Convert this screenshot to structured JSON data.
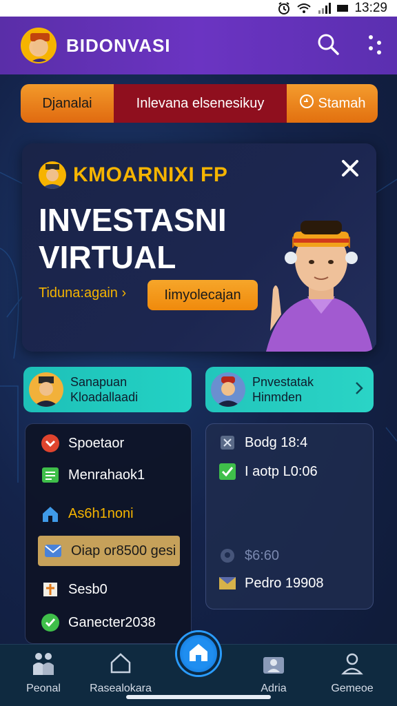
{
  "status_bar": {
    "time": "13:29"
  },
  "header": {
    "title": "BIDONVASI"
  },
  "tabs": [
    {
      "label": "Djanalai"
    },
    {
      "label": "Inlevana elsenesikuy"
    },
    {
      "label": "Stamah"
    }
  ],
  "hero": {
    "subtitle": "KMOARNIXI FP",
    "title_line1": "INVESTASNI",
    "title_line2": "VIRTUAL",
    "cta_text": "Tiduna:again",
    "cta_button": "Iimyolecajan"
  },
  "mini_cards": [
    {
      "line1": "Sanapuan",
      "line2": "Kloadallaadi"
    },
    {
      "line1": "Pnvestatak",
      "line2": "Hinmden"
    }
  ],
  "list": [
    {
      "label": "Spoetaor",
      "icon": "chevron-down-circle-icon"
    },
    {
      "label": "Menrahaok1",
      "icon": "document-green-icon"
    },
    {
      "label": "As6h1noni",
      "icon": "home-icon"
    },
    {
      "label": "Oiap or8500 gesi",
      "icon": "envelope-icon"
    },
    {
      "label": "Sesb0",
      "icon": "cross-icon"
    },
    {
      "label": "Ganecter2038",
      "icon": "check-circle-icon"
    }
  ],
  "info": [
    {
      "label": "Bodg 18:4",
      "icon": "sprite-icon"
    },
    {
      "label": "I aotp L0:06",
      "icon": "checkbox-icon"
    },
    {
      "label": "$6:60",
      "icon": "location-icon"
    },
    {
      "label": "Pedro 19908",
      "icon": "mail-icon"
    }
  ],
  "nav": [
    {
      "label": "Peonal"
    },
    {
      "label": "Rasealokara"
    },
    {
      "label": "Adria"
    },
    {
      "label": "Gemeoe"
    }
  ],
  "colors": {
    "header": "#6b34c2",
    "accent_orange": "#f08a0c",
    "accent_teal": "#23d2c4",
    "tab_red": "#8f0f1e",
    "gold": "#f5b400"
  }
}
